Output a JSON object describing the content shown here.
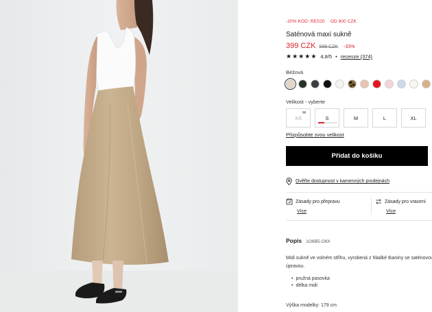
{
  "product": {
    "promo_code": "-20% KÓD: RES20",
    "promo_min": "OD 900 CZK",
    "title": "Saténová maxi sukně",
    "price_now": "399 CZK",
    "price_old": "599 CZK",
    "discount": "-33%",
    "rating_stars": 5,
    "rating_value": "4,8/5",
    "rating_separator": "•",
    "reviews_label": "recenze (374)"
  },
  "color": {
    "label": "Béžová",
    "swatches": [
      {
        "name": "beige",
        "hex": "#e4d6c2",
        "selected": true
      },
      {
        "name": "dark-green",
        "hex": "#243326"
      },
      {
        "name": "dark-grey",
        "hex": "#3a3d40"
      },
      {
        "name": "black",
        "hex": "#111111"
      },
      {
        "name": "white",
        "hex": "#f4f4f2"
      },
      {
        "name": "leopard",
        "hex": "#8a6a3e"
      },
      {
        "name": "nude",
        "hex": "#e8c3b3"
      },
      {
        "name": "red",
        "hex": "#e3141e"
      },
      {
        "name": "pale-pink",
        "hex": "#f1d4da"
      },
      {
        "name": "light-blue",
        "hex": "#cfd8e8"
      },
      {
        "name": "ivory",
        "hex": "#f7f6f2"
      },
      {
        "name": "tan",
        "hex": "#d8b08a"
      }
    ]
  },
  "size": {
    "label": "Velikost -  vyberte",
    "options": [
      {
        "label": "XS",
        "disabled": true,
        "notify_icon": "mail-icon"
      },
      {
        "label": "S",
        "low_stock": true
      },
      {
        "label": "M"
      },
      {
        "label": "L"
      },
      {
        "label": "XL"
      }
    ],
    "customize_label": "Přizpůsobte svou velikost"
  },
  "cart": {
    "add_label": "Přidat do košíku"
  },
  "store": {
    "label": "Ověřte dostupnost v kamenných prodejnách",
    "icon": "location-pin-icon"
  },
  "policies": [
    {
      "label": "Zásady pro přepravu",
      "more": "Více",
      "icon": "package-icon"
    },
    {
      "label": "Zásady pro vracení",
      "more": "Více",
      "icon": "return-arrows-icon"
    }
  ],
  "description": {
    "title": "Popis",
    "code": "1O6B5-O8X",
    "text": "Midi sukně ve volném střihu, vyrobená z hladké tkaniny se saténovou úpravou.",
    "bullets": [
      "pružná pasovka",
      "délka midi"
    ],
    "model_height": "Výška modelky: 179 cm"
  },
  "colors": {
    "accent_red": "#d9212a",
    "button_bg": "#000000"
  }
}
